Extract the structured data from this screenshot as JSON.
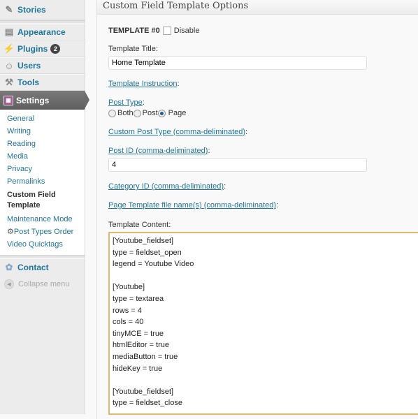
{
  "sidebar": {
    "top_items": [
      {
        "label": "Stories",
        "icon": "pushpin-icon"
      }
    ],
    "items": [
      {
        "label": "Appearance",
        "icon": "appearance-icon"
      },
      {
        "label": "Plugins",
        "icon": "plugin-icon",
        "badge": "2"
      },
      {
        "label": "Users",
        "icon": "users-icon"
      },
      {
        "label": "Tools",
        "icon": "tools-icon"
      },
      {
        "label": "Settings",
        "icon": "settings-icon",
        "active": true
      }
    ],
    "submenu": [
      {
        "label": "General"
      },
      {
        "label": "Writing"
      },
      {
        "label": "Reading"
      },
      {
        "label": "Media"
      },
      {
        "label": "Privacy"
      },
      {
        "label": "Permalinks"
      },
      {
        "label": "Custom Field Template",
        "current": true
      },
      {
        "label": "Maintenance Mode"
      },
      {
        "label": "Post Types Order",
        "icon": "gear-icon"
      },
      {
        "label": "Video Quicktags"
      }
    ],
    "contact": {
      "label": "Contact",
      "icon": "contact-icon"
    },
    "collapse": {
      "label": "Collapse menu"
    }
  },
  "panel": {
    "title": "Custom Field Template Options",
    "template_heading": "TEMPLATE #0",
    "disable_label": "Disable",
    "disable_checked": false,
    "template_title_label": "Template Title:",
    "template_title_value": "Home Template",
    "template_instruction_link": "Template Instruction",
    "colon": ":",
    "post_type_link": "Post Type",
    "post_type_options": [
      "Both",
      "Post",
      "Page"
    ],
    "post_type_selected": "Page",
    "custom_post_type_link": "Custom Post Type (comma-deliminated)",
    "post_id_link": "Post ID (comma-deliminated)",
    "post_id_value": "4",
    "category_id_link": "Category ID (comma-deliminated)",
    "page_template_link": "Page Template file name(s) (comma-deliminated)",
    "template_content_label": "Template Content:",
    "template_content_value": "[Youtube_fieldset]\ntype = fieldset_open\nlegend = Youtube Video\n\n[Youtube]\ntype = textarea\nrows = 4\ncols = 40\ntinyMCE = true\nhtmlEditor = true\nmediaButton = true\nhideKey = true\n\n[Youtube_fieldset]\ntype = fieldset_close"
  }
}
